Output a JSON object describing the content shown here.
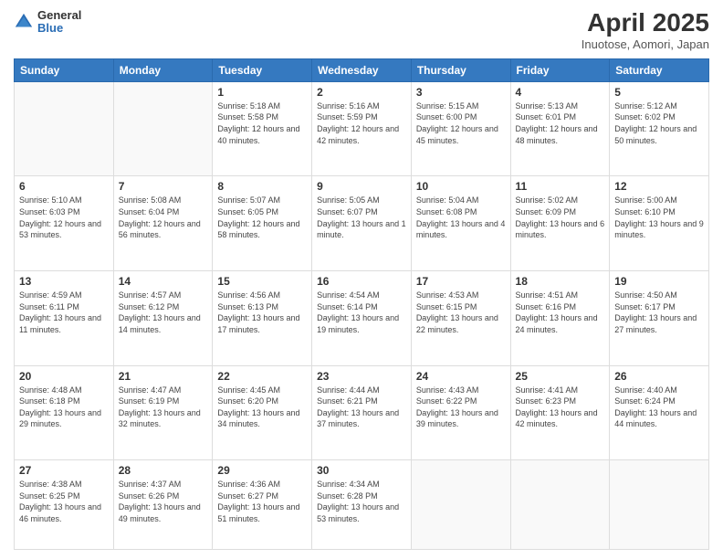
{
  "header": {
    "logo_general": "General",
    "logo_blue": "Blue",
    "title": "April 2025",
    "location": "Inuotose, Aomori, Japan"
  },
  "days_of_week": [
    "Sunday",
    "Monday",
    "Tuesday",
    "Wednesday",
    "Thursday",
    "Friday",
    "Saturday"
  ],
  "weeks": [
    [
      {
        "day": "",
        "sunrise": "",
        "sunset": "",
        "daylight": ""
      },
      {
        "day": "",
        "sunrise": "",
        "sunset": "",
        "daylight": ""
      },
      {
        "day": "1",
        "sunrise": "Sunrise: 5:18 AM",
        "sunset": "Sunset: 5:58 PM",
        "daylight": "Daylight: 12 hours and 40 minutes."
      },
      {
        "day": "2",
        "sunrise": "Sunrise: 5:16 AM",
        "sunset": "Sunset: 5:59 PM",
        "daylight": "Daylight: 12 hours and 42 minutes."
      },
      {
        "day": "3",
        "sunrise": "Sunrise: 5:15 AM",
        "sunset": "Sunset: 6:00 PM",
        "daylight": "Daylight: 12 hours and 45 minutes."
      },
      {
        "day": "4",
        "sunrise": "Sunrise: 5:13 AM",
        "sunset": "Sunset: 6:01 PM",
        "daylight": "Daylight: 12 hours and 48 minutes."
      },
      {
        "day": "5",
        "sunrise": "Sunrise: 5:12 AM",
        "sunset": "Sunset: 6:02 PM",
        "daylight": "Daylight: 12 hours and 50 minutes."
      }
    ],
    [
      {
        "day": "6",
        "sunrise": "Sunrise: 5:10 AM",
        "sunset": "Sunset: 6:03 PM",
        "daylight": "Daylight: 12 hours and 53 minutes."
      },
      {
        "day": "7",
        "sunrise": "Sunrise: 5:08 AM",
        "sunset": "Sunset: 6:04 PM",
        "daylight": "Daylight: 12 hours and 56 minutes."
      },
      {
        "day": "8",
        "sunrise": "Sunrise: 5:07 AM",
        "sunset": "Sunset: 6:05 PM",
        "daylight": "Daylight: 12 hours and 58 minutes."
      },
      {
        "day": "9",
        "sunrise": "Sunrise: 5:05 AM",
        "sunset": "Sunset: 6:07 PM",
        "daylight": "Daylight: 13 hours and 1 minute."
      },
      {
        "day": "10",
        "sunrise": "Sunrise: 5:04 AM",
        "sunset": "Sunset: 6:08 PM",
        "daylight": "Daylight: 13 hours and 4 minutes."
      },
      {
        "day": "11",
        "sunrise": "Sunrise: 5:02 AM",
        "sunset": "Sunset: 6:09 PM",
        "daylight": "Daylight: 13 hours and 6 minutes."
      },
      {
        "day": "12",
        "sunrise": "Sunrise: 5:00 AM",
        "sunset": "Sunset: 6:10 PM",
        "daylight": "Daylight: 13 hours and 9 minutes."
      }
    ],
    [
      {
        "day": "13",
        "sunrise": "Sunrise: 4:59 AM",
        "sunset": "Sunset: 6:11 PM",
        "daylight": "Daylight: 13 hours and 11 minutes."
      },
      {
        "day": "14",
        "sunrise": "Sunrise: 4:57 AM",
        "sunset": "Sunset: 6:12 PM",
        "daylight": "Daylight: 13 hours and 14 minutes."
      },
      {
        "day": "15",
        "sunrise": "Sunrise: 4:56 AM",
        "sunset": "Sunset: 6:13 PM",
        "daylight": "Daylight: 13 hours and 17 minutes."
      },
      {
        "day": "16",
        "sunrise": "Sunrise: 4:54 AM",
        "sunset": "Sunset: 6:14 PM",
        "daylight": "Daylight: 13 hours and 19 minutes."
      },
      {
        "day": "17",
        "sunrise": "Sunrise: 4:53 AM",
        "sunset": "Sunset: 6:15 PM",
        "daylight": "Daylight: 13 hours and 22 minutes."
      },
      {
        "day": "18",
        "sunrise": "Sunrise: 4:51 AM",
        "sunset": "Sunset: 6:16 PM",
        "daylight": "Daylight: 13 hours and 24 minutes."
      },
      {
        "day": "19",
        "sunrise": "Sunrise: 4:50 AM",
        "sunset": "Sunset: 6:17 PM",
        "daylight": "Daylight: 13 hours and 27 minutes."
      }
    ],
    [
      {
        "day": "20",
        "sunrise": "Sunrise: 4:48 AM",
        "sunset": "Sunset: 6:18 PM",
        "daylight": "Daylight: 13 hours and 29 minutes."
      },
      {
        "day": "21",
        "sunrise": "Sunrise: 4:47 AM",
        "sunset": "Sunset: 6:19 PM",
        "daylight": "Daylight: 13 hours and 32 minutes."
      },
      {
        "day": "22",
        "sunrise": "Sunrise: 4:45 AM",
        "sunset": "Sunset: 6:20 PM",
        "daylight": "Daylight: 13 hours and 34 minutes."
      },
      {
        "day": "23",
        "sunrise": "Sunrise: 4:44 AM",
        "sunset": "Sunset: 6:21 PM",
        "daylight": "Daylight: 13 hours and 37 minutes."
      },
      {
        "day": "24",
        "sunrise": "Sunrise: 4:43 AM",
        "sunset": "Sunset: 6:22 PM",
        "daylight": "Daylight: 13 hours and 39 minutes."
      },
      {
        "day": "25",
        "sunrise": "Sunrise: 4:41 AM",
        "sunset": "Sunset: 6:23 PM",
        "daylight": "Daylight: 13 hours and 42 minutes."
      },
      {
        "day": "26",
        "sunrise": "Sunrise: 4:40 AM",
        "sunset": "Sunset: 6:24 PM",
        "daylight": "Daylight: 13 hours and 44 minutes."
      }
    ],
    [
      {
        "day": "27",
        "sunrise": "Sunrise: 4:38 AM",
        "sunset": "Sunset: 6:25 PM",
        "daylight": "Daylight: 13 hours and 46 minutes."
      },
      {
        "day": "28",
        "sunrise": "Sunrise: 4:37 AM",
        "sunset": "Sunset: 6:26 PM",
        "daylight": "Daylight: 13 hours and 49 minutes."
      },
      {
        "day": "29",
        "sunrise": "Sunrise: 4:36 AM",
        "sunset": "Sunset: 6:27 PM",
        "daylight": "Daylight: 13 hours and 51 minutes."
      },
      {
        "day": "30",
        "sunrise": "Sunrise: 4:34 AM",
        "sunset": "Sunset: 6:28 PM",
        "daylight": "Daylight: 13 hours and 53 minutes."
      },
      {
        "day": "",
        "sunrise": "",
        "sunset": "",
        "daylight": ""
      },
      {
        "day": "",
        "sunrise": "",
        "sunset": "",
        "daylight": ""
      },
      {
        "day": "",
        "sunrise": "",
        "sunset": "",
        "daylight": ""
      }
    ]
  ]
}
